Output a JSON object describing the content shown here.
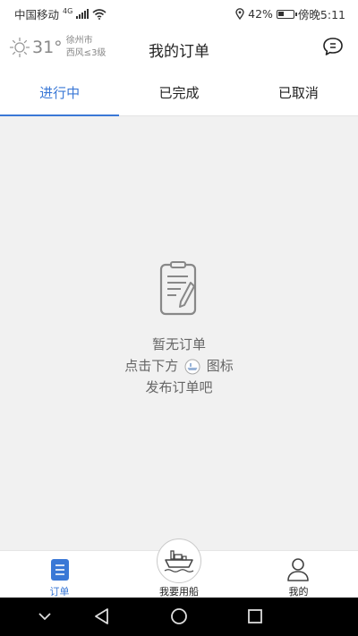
{
  "status_bar": {
    "carrier": "中国移动",
    "network": "4G",
    "battery": "42%",
    "battery_level": 0.42,
    "time": "傍晚5:11",
    "icons": [
      "signal-icon",
      "wifi-icon",
      "location-icon",
      "battery-icon"
    ]
  },
  "header": {
    "temperature": "31°",
    "city": "徐州市",
    "wind": "西风≤3级",
    "title": "我的订单",
    "weather_icon": "sun-icon",
    "message_icon": "chat-bubble-icon"
  },
  "tabs": [
    {
      "label": "进行中",
      "active": true
    },
    {
      "label": "已完成",
      "active": false
    },
    {
      "label": "已取消",
      "active": false
    }
  ],
  "empty_state": {
    "icon": "clipboard-edit-icon",
    "line1": "暂无订单",
    "line2_before": "点击下方",
    "line2_after": "图标",
    "line3": "发布订单吧",
    "inline_icon": "ship-icon"
  },
  "bottom_nav": [
    {
      "label": "订单",
      "icon": "order-list-icon",
      "active": true
    },
    {
      "label": "我要用船",
      "icon": "ship-icon",
      "active": false
    },
    {
      "label": "我的",
      "icon": "user-icon",
      "active": false
    }
  ],
  "colors": {
    "accent": "#3a78d6",
    "background": "#f1f1f1",
    "text_muted": "#666666"
  },
  "system_nav": [
    "chevron-down-icon",
    "back-triangle-icon",
    "home-circle-icon",
    "recents-square-icon"
  ]
}
